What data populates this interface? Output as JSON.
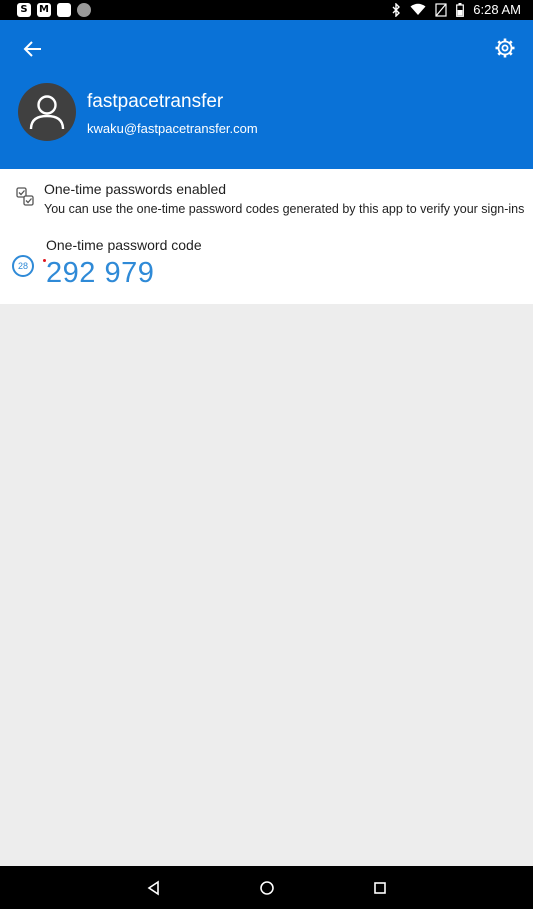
{
  "status_bar": {
    "left_icons": [
      "S",
      "M",
      "",
      ""
    ],
    "time": "6:28 AM"
  },
  "account": {
    "name": "fastpacetransfer",
    "email": "kwaku@fastpacetransfer.com"
  },
  "otp": {
    "enabled_title": "One-time passwords enabled",
    "enabled_desc": "You can use the one-time password codes generated by this app to verify your sign-ins",
    "code_label": "One-time password code",
    "code": "292 979",
    "countdown": "28"
  },
  "colors": {
    "header": "#0a72d7",
    "code": "#2f8ad7",
    "background": "#ededed"
  },
  "icons": {
    "back": "arrow-left-icon",
    "settings": "gear-icon",
    "avatar": "person-icon",
    "otp_enabled": "checkboxes-icon"
  }
}
